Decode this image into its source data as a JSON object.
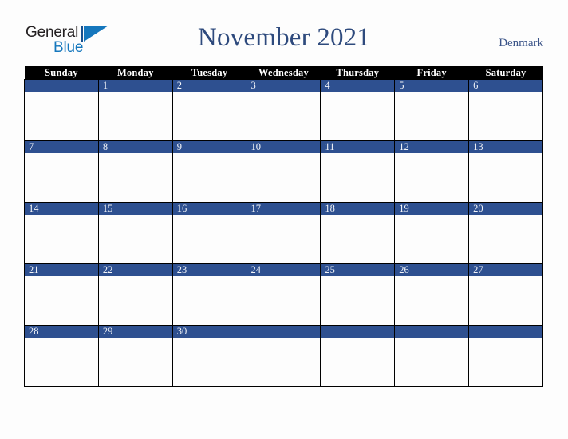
{
  "brand": {
    "name_part1": "General",
    "name_part2": "Blue",
    "mark": "triangle-logo-mark"
  },
  "header": {
    "title": "November 2021",
    "country": "Denmark"
  },
  "calendar": {
    "weekday_headers": [
      "Sunday",
      "Monday",
      "Tuesday",
      "Wednesday",
      "Thursday",
      "Friday",
      "Saturday"
    ],
    "colors": {
      "header_bg": "#000000",
      "header_text": "#ffffff",
      "day_bar": "#2e5090",
      "day_number": "#f2f4f8",
      "cell_bg": "#fdfdfd",
      "grid_line": "#000000",
      "title": "#2e4a7d",
      "country": "#3b5488",
      "logo_blue": "#1577bd",
      "logo_dark": "#231f20",
      "page_bg": "#fdfdfd"
    },
    "weeks": [
      [
        "",
        "1",
        "2",
        "3",
        "4",
        "5",
        "6"
      ],
      [
        "7",
        "8",
        "9",
        "10",
        "11",
        "12",
        "13"
      ],
      [
        "14",
        "15",
        "16",
        "17",
        "18",
        "19",
        "20"
      ],
      [
        "21",
        "22",
        "23",
        "24",
        "25",
        "26",
        "27"
      ],
      [
        "28",
        "29",
        "30",
        "",
        "",
        "",
        ""
      ]
    ],
    "week_has_bar": [
      [
        true,
        true,
        true,
        true,
        true,
        true,
        true
      ],
      [
        true,
        true,
        true,
        true,
        true,
        true,
        true
      ],
      [
        true,
        true,
        true,
        true,
        true,
        true,
        true
      ],
      [
        true,
        true,
        true,
        true,
        true,
        true,
        true
      ],
      [
        true,
        true,
        true,
        true,
        true,
        true,
        true
      ]
    ]
  }
}
